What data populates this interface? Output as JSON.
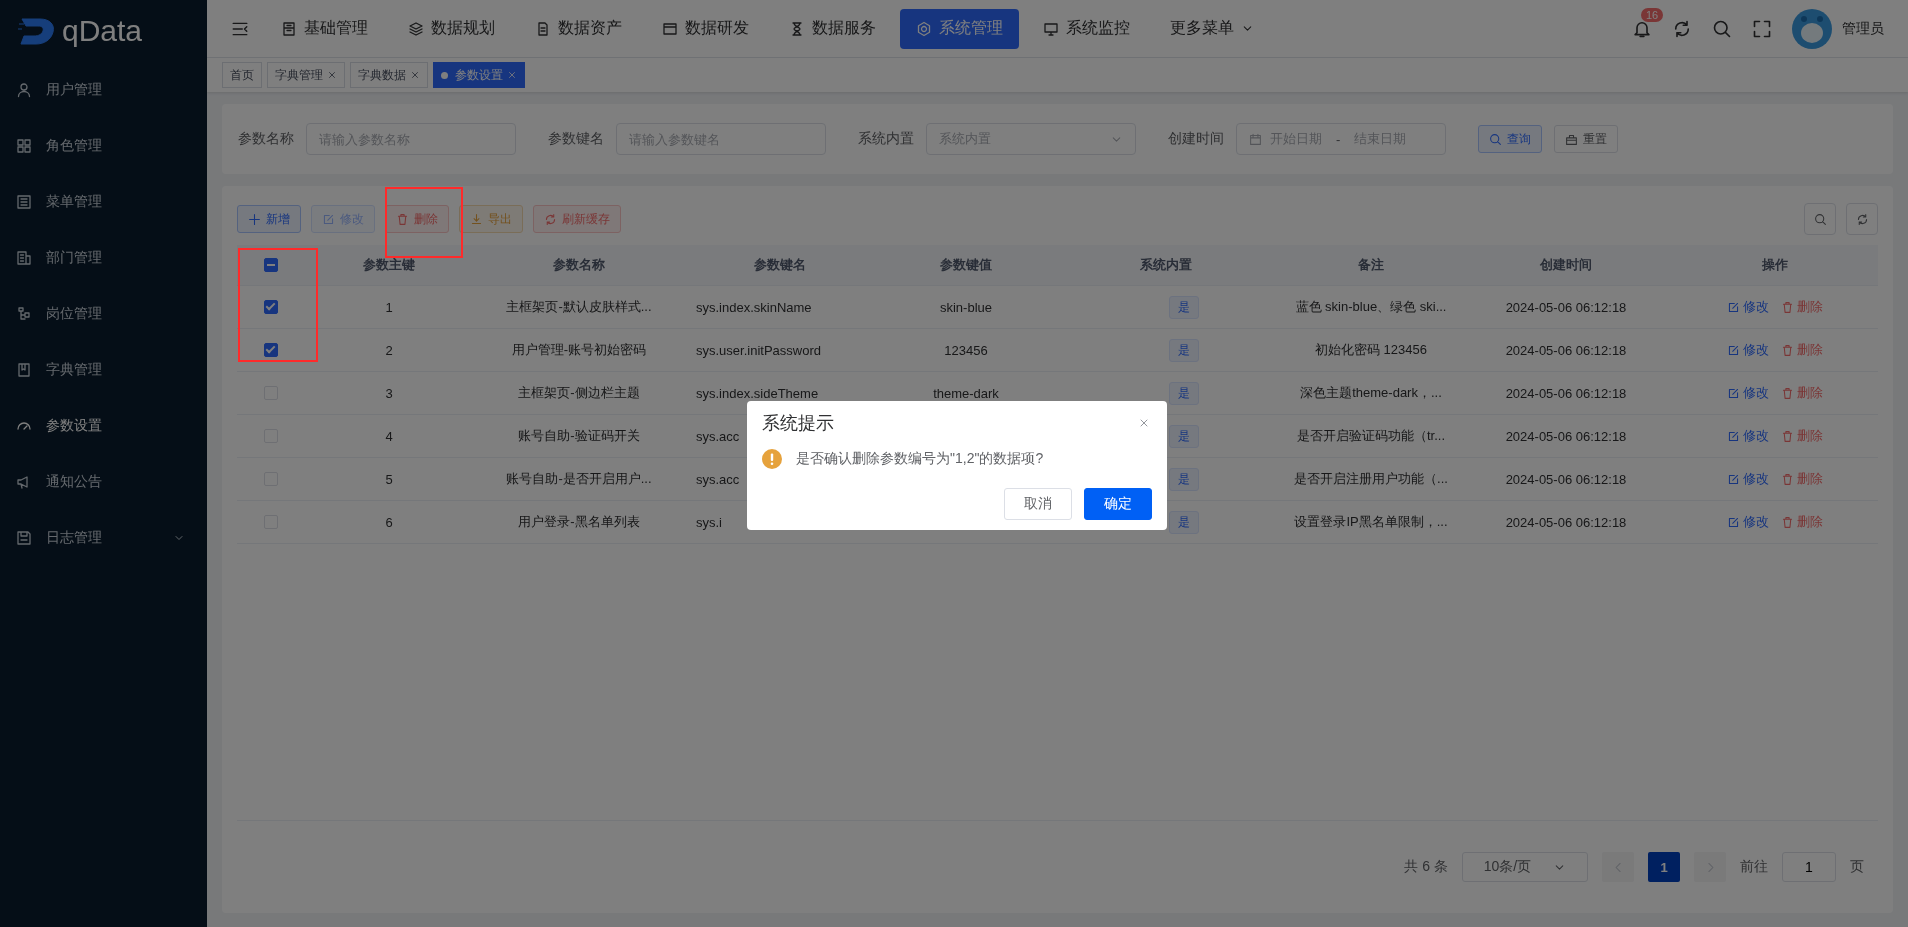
{
  "sidebar": {
    "logo": "qData",
    "items": [
      {
        "label": "用户管理",
        "selected": false,
        "kind": "link"
      },
      {
        "label": "角色管理",
        "selected": false,
        "kind": "link"
      },
      {
        "label": "菜单管理",
        "selected": false,
        "kind": "link"
      },
      {
        "label": "部门管理",
        "selected": false,
        "kind": "link"
      },
      {
        "label": "岗位管理",
        "selected": false,
        "kind": "link"
      },
      {
        "label": "字典管理",
        "selected": false,
        "kind": "link"
      },
      {
        "label": "参数设置",
        "selected": true,
        "kind": "link"
      },
      {
        "label": "通知公告",
        "selected": false,
        "kind": "link"
      },
      {
        "label": "日志管理",
        "selected": false,
        "kind": "group"
      }
    ]
  },
  "topnav": [
    {
      "label": "基础管理",
      "selected": false,
      "kind": "link"
    },
    {
      "label": "数据规划",
      "selected": false,
      "kind": "link"
    },
    {
      "label": "数据资产",
      "selected": false,
      "kind": "link"
    },
    {
      "label": "数据研发",
      "selected": false,
      "kind": "link"
    },
    {
      "label": "数据服务",
      "selected": false,
      "kind": "link"
    },
    {
      "label": "系统管理",
      "selected": true,
      "kind": "link"
    },
    {
      "label": "系统监控",
      "selected": false,
      "kind": "link"
    },
    {
      "label": "更多菜单",
      "selected": false,
      "kind": "dropdown"
    }
  ],
  "header": {
    "notification_count": "16",
    "user": "管理员"
  },
  "tabs": [
    {
      "label": "首页",
      "selected": false,
      "closable": false
    },
    {
      "label": "字典管理",
      "selected": false,
      "closable": true
    },
    {
      "label": "字典数据",
      "selected": false,
      "closable": true
    },
    {
      "label": "参数设置",
      "selected": true,
      "closable": true
    }
  ],
  "filters": [
    {
      "label": "参数名称",
      "kind": "input",
      "placeholder": "请输入参数名称"
    },
    {
      "label": "参数键名",
      "kind": "input",
      "placeholder": "请输入参数键名"
    },
    {
      "label": "系统内置",
      "kind": "select",
      "placeholder": "系统内置"
    },
    {
      "label": "创建时间",
      "kind": "daterange",
      "start_placeholder": "开始日期",
      "separator": "-",
      "end_placeholder": "结束日期"
    }
  ],
  "filter_buttons": [
    {
      "label": "查询",
      "kind": "primary"
    },
    {
      "label": "重置",
      "kind": "default"
    }
  ],
  "toolbar": [
    {
      "label": "新增",
      "kind": "primary",
      "disabled": false
    },
    {
      "label": "修改",
      "kind": "primary",
      "disabled": true
    },
    {
      "label": "删除",
      "kind": "danger",
      "disabled": false
    },
    {
      "label": "导出",
      "kind": "warning",
      "disabled": false
    },
    {
      "label": "刷新缓存",
      "kind": "danger",
      "disabled": false
    }
  ],
  "table": {
    "select_all": {
      "indeterminate": true
    },
    "columns": [
      "参数主键",
      "参数名称",
      "参数键名",
      "参数键值",
      "系统内置",
      "备注",
      "创建时间",
      "操作"
    ],
    "rows": [
      {
        "selected": true,
        "id": "1",
        "name": "主框架页-默认皮肤样式...",
        "key": "sys.index.skinName",
        "value": "skin-blue",
        "builtin": "是",
        "remark": "蓝色 skin-blue、绿色 ski...",
        "created": "2024-05-06 06:12:18",
        "actions": [
          "修改",
          "删除"
        ]
      },
      {
        "selected": true,
        "id": "2",
        "name": "用户管理-账号初始密码",
        "key": "sys.user.initPassword",
        "value": "123456",
        "builtin": "是",
        "remark": "初始化密码 123456",
        "created": "2024-05-06 06:12:18",
        "actions": [
          "修改",
          "删除"
        ]
      },
      {
        "selected": false,
        "id": "3",
        "name": "主框架页-侧边栏主题",
        "key": "sys.index.sideTheme",
        "value": "theme-dark",
        "builtin": "是",
        "remark": "深色主题theme-dark，...",
        "created": "2024-05-06 06:12:18",
        "actions": [
          "修改",
          "删除"
        ]
      },
      {
        "selected": false,
        "id": "4",
        "name": "账号自助-验证码开关",
        "key": "sys.acc",
        "builtin": "是",
        "remark": "是否开启验证码功能（tr...",
        "created": "2024-05-06 06:12:18",
        "actions": [
          "修改",
          "删除"
        ]
      },
      {
        "selected": false,
        "id": "5",
        "name": "账号自助-是否开启用户...",
        "key": "sys.acc",
        "builtin": "是",
        "remark": "是否开启注册用户功能（...",
        "created": "2024-05-06 06:12:18",
        "actions": [
          "修改",
          "删除"
        ]
      },
      {
        "selected": false,
        "id": "6",
        "name": "用户登录-黑名单列表",
        "key": "sys.i",
        "builtin": "是",
        "remark": "设置登录IP黑名单限制，...",
        "created": "2024-05-06 06:12:18",
        "actions": [
          "修改",
          "删除"
        ]
      }
    ]
  },
  "pagination": {
    "total": "共 6 条",
    "page_size": "10条/页",
    "prev_disabled": true,
    "next_disabled": true,
    "pages": [
      {
        "label": "1",
        "selected": true
      }
    ],
    "goto_label": "前往",
    "goto_value": "1",
    "goto_suffix": "页"
  },
  "dialog": {
    "title": "系统提示",
    "message": "是否确认删除参数编号为\"1,2\"的数据项?",
    "buttons": [
      {
        "label": "取消",
        "kind": "default"
      },
      {
        "label": "确定",
        "kind": "primary"
      }
    ]
  }
}
